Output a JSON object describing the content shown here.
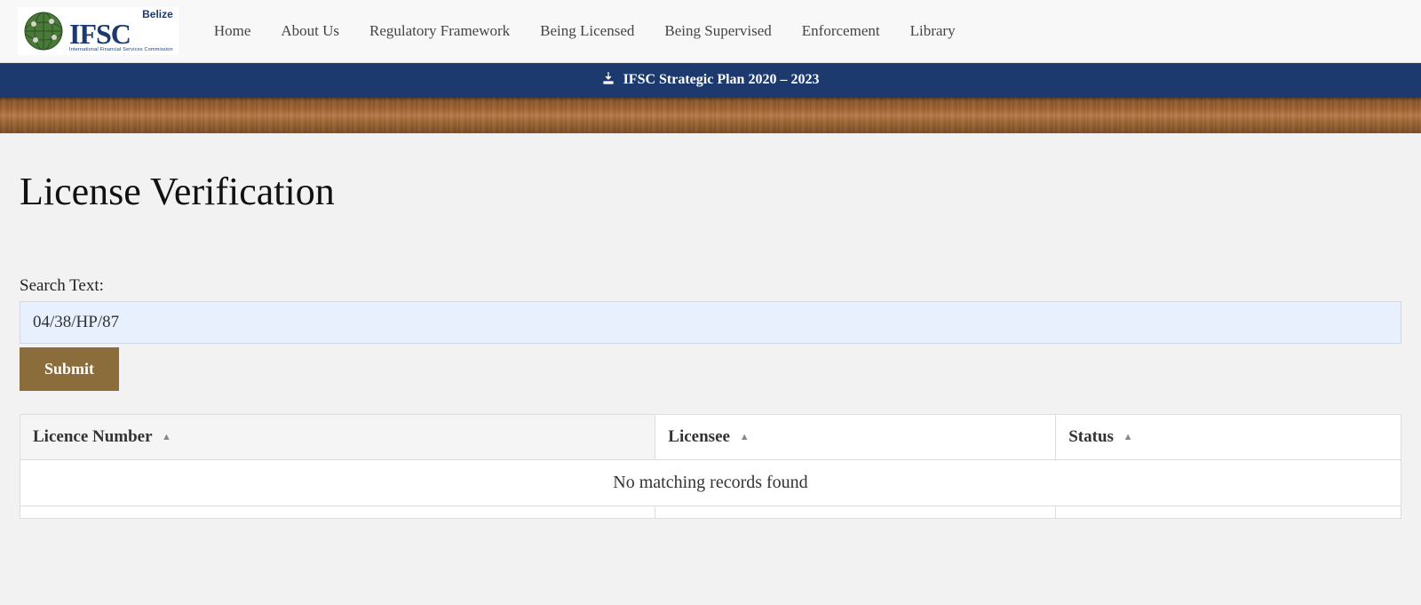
{
  "logo": {
    "belize": "Belize",
    "ifsc": "IFSC",
    "sub": "International Financial Services Commission"
  },
  "nav": {
    "items": [
      "Home",
      "About Us",
      "Regulatory Framework",
      "Being Licensed",
      "Being Supervised",
      "Enforcement",
      "Library"
    ]
  },
  "banner": {
    "text": "IFSC Strategic Plan 2020 – 2023"
  },
  "page": {
    "title": "License Verification"
  },
  "search": {
    "label": "Search Text:",
    "value": "04/38/HP/87",
    "submit": "Submit"
  },
  "table": {
    "columns": [
      "Licence Number",
      "Licensee",
      "Status"
    ],
    "no_records": "No matching records found"
  }
}
